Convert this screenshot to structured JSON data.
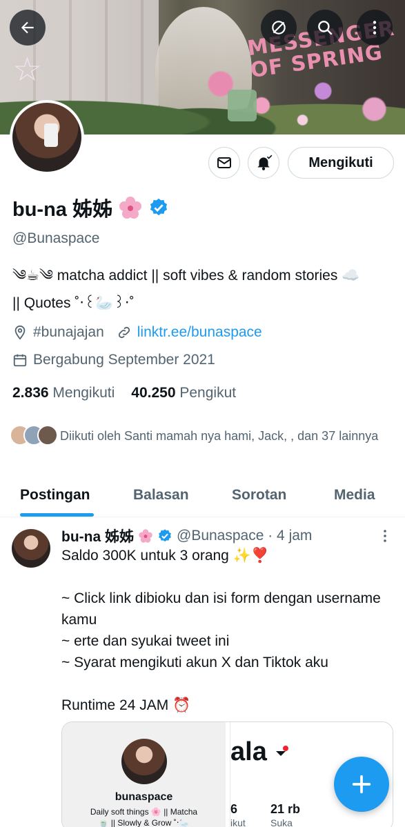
{
  "banner": {
    "text": "MESSENGER OF SPRING"
  },
  "profile": {
    "name": "bu-na 姊姊",
    "handle": "@Bunaspace",
    "bio_line1": "༄☕༄ matcha addict || soft vibes & random stories ☁️",
    "bio_line2": "|| Quotes ˚‧꒰🦢꒱‧˚",
    "location": "#bunajajan",
    "link": "linktr.ee/bunaspace",
    "joined": "Bergabung September 2021",
    "following_count": "2.836",
    "following_label": "Mengikuti",
    "followers_count": "40.250",
    "followers_label": "Pengikut",
    "followed_by": "Diikuti oleh Santi mamah nya hami, Jack,          , dan 37 lainnya",
    "follow_button": "Mengikuti"
  },
  "icons": {
    "back": "arrow-left-icon",
    "hide": "eye-slash-icon",
    "search": "search-icon",
    "more": "more-vertical-icon",
    "message": "envelope-icon",
    "notify": "bell-icon",
    "verified": "verified-badge-icon",
    "compose": "plus-icon"
  },
  "tabs": [
    {
      "label": "Postingan"
    },
    {
      "label": "Balasan"
    },
    {
      "label": "Sorotan"
    },
    {
      "label": "Media"
    }
  ],
  "tweet": {
    "name": "bu-na 姊姊",
    "handle_time": "@Bunaspace · 4 jam",
    "text": "Saldo 300K untuk 3 orang ✨❣️\n\n~ Click link dibioku dan isi form dengan username kamu\n~ erte dan syukai tweet ini\n~ Syarat mengikuti akun X dan Tiktok aku\n\nRuntime 24 JAM ⏰",
    "card": {
      "name": "bunaspace",
      "desc_line1": "Daily soft things 🌸 || Matcha",
      "desc_line2": "🍵 || Slowly & Grow ˚‧🦢",
      "big_text": "ala",
      "stat1_value": "6",
      "stat1_label": "ikut",
      "stat2_value": "21 rb",
      "stat2_label": "Suka"
    }
  },
  "colors": {
    "accent": "#1d9bf0",
    "text": "#0f1419",
    "muted": "#536471"
  }
}
